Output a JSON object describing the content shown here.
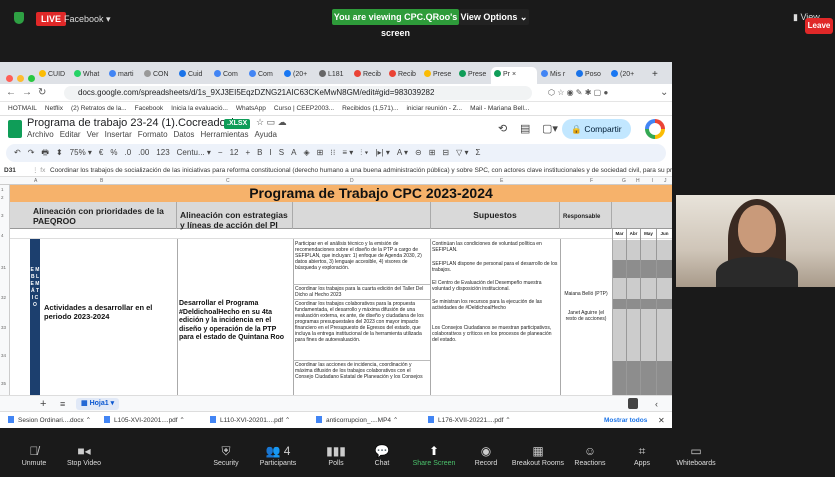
{
  "zoom_top": {
    "live_badge": "LIVE",
    "stream_target": "Facebook ▾",
    "viewing_banner": "You are viewing CPC.QRoo's screen",
    "view_options": "View Options  ⌄",
    "view_label": "▮ View"
  },
  "browser": {
    "tabs": [
      {
        "label": "CUID"
      },
      {
        "label": "What"
      },
      {
        "label": "marti"
      },
      {
        "label": "CON"
      },
      {
        "label": "Cuid"
      },
      {
        "label": "Com"
      },
      {
        "label": "Com"
      },
      {
        "label": "(20+"
      },
      {
        "label": "L181"
      },
      {
        "label": "Recib"
      },
      {
        "label": "Recib"
      },
      {
        "label": "Prese"
      },
      {
        "label": "Prese"
      },
      {
        "label": "Pr ×",
        "active": true
      },
      {
        "label": "Mis r"
      },
      {
        "label": "Poso"
      },
      {
        "label": "(20+"
      }
    ],
    "new_tab": "+",
    "url": "docs.google.com/spreadsheets/d/1s_9XJ3EI5EqzDZNG21AIC63CKeMwN8GM/edit#gid=983039282",
    "bookmarks": [
      "HOTMAIL",
      "Netflix",
      "(2) Retratos de la...",
      "Facebook",
      "Inicia la evaluació...",
      "WhatsApp",
      "Curso | CEEP2003...",
      "Recibidos (1,571)...",
      "iniciar reunión - Z...",
      "Mail - Mariana Bell..."
    ]
  },
  "sheets": {
    "doc_title": "Programa de trabajo 23-24 (1).Cocreadoxlsx",
    "file_badge": ".XLSX",
    "menu": [
      "Archivo",
      "Editar",
      "Ver",
      "Insertar",
      "Formato",
      "Datos",
      "Herramientas",
      "Ayuda"
    ],
    "share_label": "Compartir",
    "toolbar": [
      "↶",
      "↷",
      "🖶",
      "⬍",
      "75%  ▾",
      "€",
      "%",
      ".0",
      ".00",
      "123",
      "Centu...  ▾",
      "−",
      "12",
      "+",
      "B",
      "I",
      "S",
      "A",
      "◈",
      "⊞",
      "⁝⁝",
      "≡ ▾",
      "⫶ ▾",
      "|▸| ▾",
      "A ▾",
      "⊝",
      "⊞",
      "⊟",
      "▽ ▾",
      "Σ"
    ],
    "cell_ref": "D31",
    "formula": "Coordinar los trabajos de socialización de las iniciativas para reforma constitucional (derecho humano a una buena administración pública) y sobre SPC, con actores clave institucionales y de sociedad civil, para su presentación en",
    "col_letters": [
      "A",
      "B",
      "C",
      "D",
      "E",
      "F",
      "G",
      "H",
      "I",
      "J"
    ],
    "row_numbers": [
      "1",
      "2",
      "3",
      "4",
      "31",
      "32",
      "33",
      "34",
      "35"
    ],
    "sheet_tab": "Hoja1",
    "grid": {
      "title": "Programa de Trabajo CPC 2023-2024",
      "headers": [
        "Alineación con prioridades de la PAEQROO",
        "Alineación con estrategias y líneas de acción del PI",
        "Supuestos",
        "Responsable"
      ],
      "months": [
        "Mar",
        "Abr",
        "May",
        "Jun"
      ],
      "vertical_label": "E M B L E M Á T I C O",
      "activities_label": "Actividades a desarrollar en el periodo 2023-2024",
      "pi_text": "Desarrollar el Programa #DeldichoalHecho en su 4ta edición y la incidencia en el diseño y operación de la PTP para el estado de Quintana Roo",
      "actions": [
        "Participar en el análisis técnico y la emisión de recomendaciones sobre el diseño de la PTP a cargo de SEFIPLAN, que incluyan: 1) enfoque de Agenda 2030, 2) datos abiertos, 3) lenguaje accesible, 4) visores de búsqueda y exploración.",
        "Coordinar los trabajos para la cuarta edición del Taller Del Dicho al Hecho 2023",
        "Coordinar los trabajos colaborativos para la propuesta fundamentada, el desarrollo y máxima difusión de una evaluación externa, ex ante, de diseño y ciudadana de los programas presupuestales del 2023 con mayor impacto financiero en el Presupuesto de Egresos del estado, que incluya la entrega institucional de la herramienta utilizada para fines de autoevaluación.",
        "Coordinar las acciones de incidencia, coordinación y máxima difusión de los trabajos colaborativos con el Consejo Ciudadano Estatal de Planeación y los Consejos"
      ],
      "supuestos": [
        "Continúan las condiciones de voluntad política en SEFIPLAN.",
        "SEFIPLAN dispone de personal para el desarrollo de los trabajos.",
        "El Centro de Evaluación del Desempeño muestra voluntad y disposición institucional.",
        "Se ministran los recursos para la ejecución de las actividades de #DeldichoalHecho",
        "Los Consejos Ciudadanos se muestran participativos, colaborativos y críticos en los procesos de planeación del estado."
      ],
      "responsables": [
        "Maiana Belló (PTP)",
        "Janet Aguirre (el resto de acciones)"
      ]
    }
  },
  "downloads": [
    {
      "name": "Sesion Ordinari....docx"
    },
    {
      "name": "L105-XVI-20201....pdf"
    },
    {
      "name": "L110-XVI-20201....pdf"
    },
    {
      "name": "anticorrupcion_....MP4"
    },
    {
      "name": "L176-XVII-20221....pdf"
    }
  ],
  "downloads_show_all": "Mostrar todos",
  "zoom_bottom": [
    {
      "icon": "mic-muted-icon",
      "glyph": "🎙̸",
      "label": "Unmute"
    },
    {
      "icon": "video-icon",
      "glyph": "■◂",
      "label": "Stop Video"
    },
    {
      "icon": "shield-icon",
      "glyph": "⛨",
      "label": "Security"
    },
    {
      "icon": "participants-icon",
      "glyph": "👥 4",
      "label": "Participants"
    },
    {
      "icon": "polls-icon",
      "glyph": "▮▮▮",
      "label": "Polls"
    },
    {
      "icon": "chat-icon",
      "glyph": "💬",
      "label": "Chat"
    },
    {
      "icon": "share-screen-icon",
      "glyph": "⬆",
      "label": "Share Screen"
    },
    {
      "icon": "record-icon",
      "glyph": "◉",
      "label": "Record"
    },
    {
      "icon": "breakout-icon",
      "glyph": "▦",
      "label": "Breakout Rooms"
    },
    {
      "icon": "reactions-icon",
      "glyph": "☺",
      "label": "Reactions"
    },
    {
      "icon": "apps-icon",
      "glyph": "⌗",
      "label": "Apps"
    },
    {
      "icon": "whiteboards-icon",
      "glyph": "▭",
      "label": "Whiteboards"
    }
  ],
  "leave_label": "Leave",
  "colors": {
    "live": "#e02828",
    "viewing": "#2e9b3a",
    "title_fill": "#f6b26b",
    "emblem": "#1c3f6e",
    "share_btn": "#c2e7ff"
  }
}
